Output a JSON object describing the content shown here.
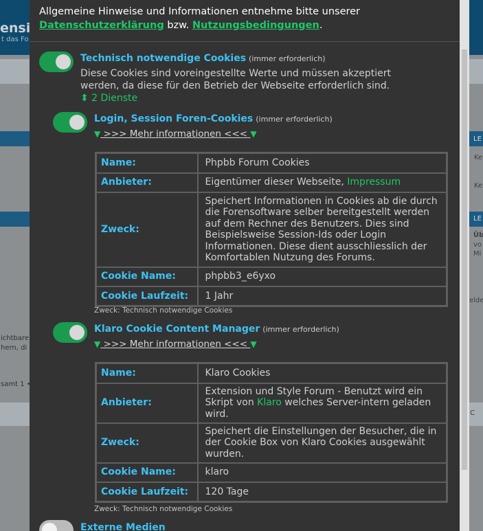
{
  "background": {
    "title": "ensio",
    "subtitle": "t das Fo",
    "right_labels": [
      "LE",
      "Ke",
      "Ke",
      "LE",
      "Üb",
      "vo",
      "Mi",
      "elde",
      "C"
    ],
    "left_texts": [
      "ichtbare",
      "hern, di",
      "samt 1 •"
    ]
  },
  "intro": {
    "text_before": "Allgemeine Hinweise und Informationen entnehme bitte unserer ",
    "privacy_link": "Datenschutzerklärung",
    "text_between": " bzw. ",
    "terms_link": "Nutzungsbedingungen",
    "text_after": "."
  },
  "category": {
    "title": "Technisch notwendige Cookies",
    "required": "(immer erforderlich)",
    "description": "Diese Cookies sind voreingestellte Werte und müssen akzeptiert werden, da diese für den Betrieb der Webseite erforderlich sind.",
    "services_toggle": "⬍ 2 Dienste",
    "enabled": true
  },
  "services": [
    {
      "title": "Login, Session Foren-Cookies",
      "required": "(immer erforderlich)",
      "more": ">>> Mehr informationen <<<",
      "rows": {
        "name_label": "Name:",
        "name": "Phpbb Forum Cookies",
        "provider_label": "Anbieter:",
        "provider_text": "Eigentümer dieser Webseite, ",
        "provider_link": "Impressum",
        "purpose_label": "Zweck:",
        "purpose": "Speichert Informationen in Cookies ab die durch die Forensoftware selber bereitgestellt werden auf dem Rechner des Benutzers. Dies sind Beispielsweise Session-Ids oder Login Informationen. Diese dient ausschliesslich der Komfortablen Nutzung des Forums.",
        "cookie_name_label": "Cookie Name:",
        "cookie_name": "phpbb3_e6yxo",
        "lifetime_label": "Cookie Laufzeit:",
        "lifetime": "1 Jahr"
      },
      "note": "Zweck: Technisch notwendige Cookies"
    },
    {
      "title": "Klaro Cookie Content Manager",
      "required": "(immer erforderlich)",
      "more": ">>> Mehr informationen <<<",
      "rows": {
        "name_label": "Name:",
        "name": "Klaro Cookies",
        "provider_label": "Anbieter:",
        "provider_before": "Extension und Style Forum - Benutzt wird ein Skript von ",
        "provider_link": "Klaro",
        "provider_after": " welches Server-intern geladen wird.",
        "purpose_label": "Zweck:",
        "purpose": "Speichert die Einstellungen der Besucher, die in der Cookie Box von Klaro Cookies ausgewählt wurden.",
        "cookie_name_label": "Cookie Name:",
        "cookie_name": "klaro",
        "lifetime_label": "Cookie Laufzeit:",
        "lifetime": "120 Tage"
      },
      "note": "Zweck: Technisch notwendige Cookies"
    }
  ],
  "external": {
    "title": "Externe Medien",
    "enabled": false
  },
  "colors": {
    "accent_green": "#1fc767",
    "toggle_green": "#1a9b50",
    "title_blue": "#3ec1f3",
    "modal_bg": "#333333"
  }
}
